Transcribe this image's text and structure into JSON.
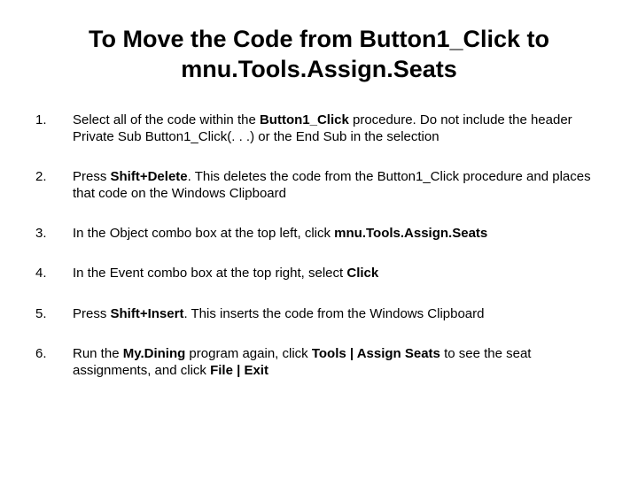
{
  "title_line1": "To Move the Code from Button1_Click to",
  "title_line2": "mnu.Tools.Assign.Seats",
  "steps": [
    {
      "html": "Select all of the code within the <span class=\"b\">Button1_Click</span> procedure. Do not include the header Private Sub Button1_Click(. . .) or the End Sub in the selection"
    },
    {
      "html": "Press <span class=\"b\">Shift+Delete</span>. This deletes the code from the Button1_Click procedure and places that code on the Windows Clipboard"
    },
    {
      "html": "In the Object combo box at the top left, click <span class=\"b\">mnu.Tools.Assign.Seats</span>"
    },
    {
      "html": "In the Event combo box at the top right, select <span class=\"b\">Click</span>"
    },
    {
      "html": "Press <span class=\"b\">Shift+Insert</span>. This inserts the code from the Windows Clipboard"
    },
    {
      "html": "Run the <span class=\"b\">My.Dining</span> program again, click <span class=\"b\">Tools | Assign Seats</span> to see the seat assignments, and click <span class=\"b\">File | Exit</span>"
    }
  ]
}
